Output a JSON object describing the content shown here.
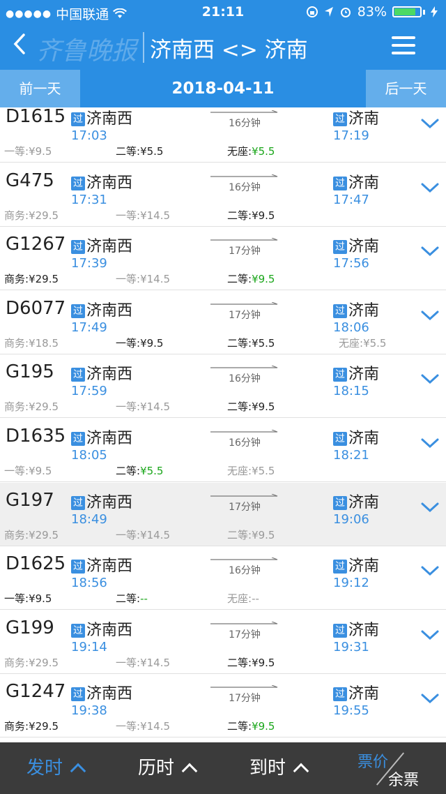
{
  "status_bar": {
    "signal": "●●●●●",
    "carrier": "中国联通",
    "time": "21:11",
    "battery": "83%",
    "battery_level": 0.83
  },
  "nav": {
    "title": "济南西 <> 济南",
    "watermark": "齐鲁晚报"
  },
  "date_bar": {
    "prev": "前一天",
    "date": "2018-04-11",
    "next": "后一天"
  },
  "tag_text": "过",
  "trains": [
    {
      "no": "D1615",
      "from": "济南西",
      "dep": "17:03",
      "to": "济南",
      "arr": "17:19",
      "duration": "16分钟",
      "highlight": false,
      "seats": [
        {
          "label": "一等:",
          "price": "¥9.5",
          "avail": false,
          "green": false
        },
        {
          "label": "二等:",
          "price": "¥5.5",
          "avail": true,
          "green": false
        },
        {
          "label": "无座:",
          "price": "¥5.5",
          "avail": true,
          "green": true
        }
      ]
    },
    {
      "no": "G475",
      "from": "济南西",
      "dep": "17:31",
      "to": "济南",
      "arr": "17:47",
      "duration": "16分钟",
      "highlight": false,
      "seats": [
        {
          "label": "商务:",
          "price": "¥29.5",
          "avail": false,
          "green": false
        },
        {
          "label": "一等:",
          "price": "¥14.5",
          "avail": false,
          "green": false
        },
        {
          "label": "二等:",
          "price": "¥9.5",
          "avail": true,
          "green": false
        }
      ]
    },
    {
      "no": "G1267",
      "from": "济南西",
      "dep": "17:39",
      "to": "济南",
      "arr": "17:56",
      "duration": "17分钟",
      "highlight": false,
      "seats": [
        {
          "label": "商务:",
          "price": "¥29.5",
          "avail": true,
          "green": false
        },
        {
          "label": "一等:",
          "price": "¥14.5",
          "avail": false,
          "green": false
        },
        {
          "label": "二等:",
          "price": "¥9.5",
          "avail": true,
          "green": true
        }
      ]
    },
    {
      "no": "D6077",
      "from": "济南西",
      "dep": "17:49",
      "to": "济南",
      "arr": "18:06",
      "duration": "17分钟",
      "highlight": false,
      "seats": [
        {
          "label": "商务:",
          "price": "¥18.5",
          "avail": false,
          "green": false
        },
        {
          "label": "一等:",
          "price": "¥9.5",
          "avail": true,
          "green": false
        },
        {
          "label": "二等:",
          "price": "¥5.5",
          "avail": true,
          "green": false
        },
        {
          "label": "无座:",
          "price": "¥5.5",
          "avail": false,
          "green": false
        }
      ]
    },
    {
      "no": "G195",
      "from": "济南西",
      "dep": "17:59",
      "to": "济南",
      "arr": "18:15",
      "duration": "16分钟",
      "highlight": false,
      "seats": [
        {
          "label": "商务:",
          "price": "¥29.5",
          "avail": false,
          "green": false
        },
        {
          "label": "一等:",
          "price": "¥14.5",
          "avail": false,
          "green": false
        },
        {
          "label": "二等:",
          "price": "¥9.5",
          "avail": true,
          "green": false
        }
      ]
    },
    {
      "no": "D1635",
      "from": "济南西",
      "dep": "18:05",
      "to": "济南",
      "arr": "18:21",
      "duration": "16分钟",
      "highlight": false,
      "seats": [
        {
          "label": "一等:",
          "price": "¥9.5",
          "avail": false,
          "green": false
        },
        {
          "label": "二等:",
          "price": "¥5.5",
          "avail": true,
          "green": true
        },
        {
          "label": "无座:",
          "price": "¥5.5",
          "avail": false,
          "green": false
        }
      ]
    },
    {
      "no": "G197",
      "from": "济南西",
      "dep": "18:49",
      "to": "济南",
      "arr": "19:06",
      "duration": "17分钟",
      "highlight": true,
      "seats": [
        {
          "label": "商务:",
          "price": "¥29.5",
          "avail": false,
          "green": false
        },
        {
          "label": "一等:",
          "price": "¥14.5",
          "avail": false,
          "green": false
        },
        {
          "label": "二等:",
          "price": "¥9.5",
          "avail": false,
          "green": false
        }
      ]
    },
    {
      "no": "D1625",
      "from": "济南西",
      "dep": "18:56",
      "to": "济南",
      "arr": "19:12",
      "duration": "16分钟",
      "highlight": false,
      "seats": [
        {
          "label": "一等:",
          "price": "¥9.5",
          "avail": true,
          "green": false
        },
        {
          "label": "二等:",
          "price": "--",
          "avail": true,
          "green": true
        },
        {
          "label": "无座:",
          "price": "--",
          "avail": false,
          "green": false
        }
      ]
    },
    {
      "no": "G199",
      "from": "济南西",
      "dep": "19:14",
      "to": "济南",
      "arr": "19:31",
      "duration": "17分钟",
      "highlight": false,
      "seats": [
        {
          "label": "商务:",
          "price": "¥29.5",
          "avail": false,
          "green": false
        },
        {
          "label": "一等:",
          "price": "¥14.5",
          "avail": false,
          "green": false
        },
        {
          "label": "二等:",
          "price": "¥9.5",
          "avail": true,
          "green": false
        }
      ]
    },
    {
      "no": "G1247",
      "from": "济南西",
      "dep": "19:38",
      "to": "济南",
      "arr": "19:55",
      "duration": "17分钟",
      "highlight": false,
      "seats": [
        {
          "label": "商务:",
          "price": "¥29.5",
          "avail": true,
          "green": false
        },
        {
          "label": "一等:",
          "price": "¥14.5",
          "avail": false,
          "green": false
        },
        {
          "label": "二等:",
          "price": "¥9.5",
          "avail": true,
          "green": true
        }
      ]
    }
  ],
  "tab_bar": {
    "depart": "发时",
    "duration": "历时",
    "arrive": "到时",
    "price_top": "票价",
    "price_bottom": "余票"
  },
  "colors": {
    "primary": "#2a8ee3",
    "accent_blue": "#3a8fe0",
    "available_green": "#1aa61a",
    "tab_bar_bg": "#3b3b3b"
  }
}
